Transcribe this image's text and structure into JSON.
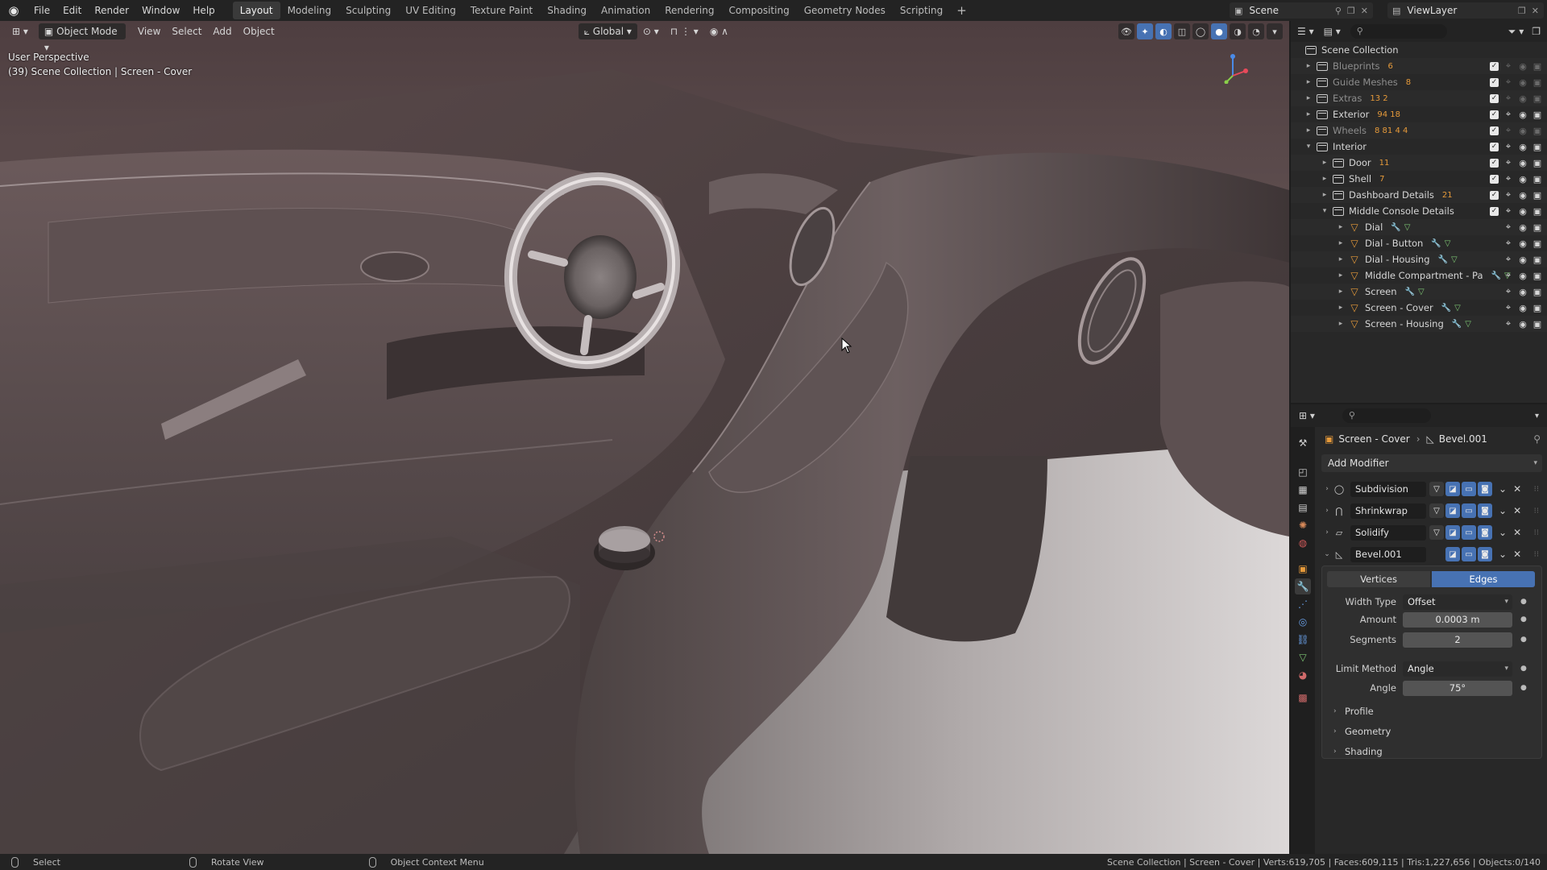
{
  "topbar": {
    "menus": [
      "File",
      "Edit",
      "Render",
      "Window",
      "Help"
    ],
    "workspaces": [
      "Layout",
      "Modeling",
      "Sculpting",
      "UV Editing",
      "Texture Paint",
      "Shading",
      "Animation",
      "Rendering",
      "Compositing",
      "Geometry Nodes",
      "Scripting"
    ],
    "active_workspace": "Layout",
    "add_workspace": "+",
    "scene": "Scene",
    "view_layer": "ViewLayer"
  },
  "viewport": {
    "mode": "Object Mode",
    "menus": [
      "View",
      "Select",
      "Add",
      "Object"
    ],
    "transform_orientation": "Global",
    "perspective": "User Perspective",
    "context": "(39) Scene Collection | Screen - Cover",
    "gizmo_axes": [
      "X",
      "Y",
      "Z"
    ]
  },
  "outliner": {
    "root": "Scene Collection",
    "rows": [
      {
        "name": "Blueprints",
        "badge": "6",
        "dim": true,
        "kind": "collection"
      },
      {
        "name": "Guide Meshes",
        "badge": "8",
        "dim": true,
        "kind": "collection"
      },
      {
        "name": "Extras",
        "badge": "13  2",
        "dim": true,
        "kind": "collection"
      },
      {
        "name": "Exterior",
        "badge": "94  18",
        "dim": false,
        "kind": "collection"
      },
      {
        "name": "Wheels",
        "badge": "8  81  4  4",
        "dim": true,
        "kind": "collection"
      },
      {
        "name": "Interior",
        "badge": "",
        "dim": false,
        "kind": "collection"
      },
      {
        "name": "Door",
        "badge": "11",
        "dim": false,
        "kind": "collection"
      },
      {
        "name": "Shell",
        "badge": "7",
        "dim": false,
        "kind": "collection"
      },
      {
        "name": "Dashboard Details",
        "badge": "21",
        "dim": false,
        "kind": "collection"
      },
      {
        "name": "Middle Console Details",
        "badge": "",
        "dim": false,
        "kind": "collection"
      },
      {
        "name": "Dial",
        "badge": "",
        "dim": false,
        "kind": "object"
      },
      {
        "name": "Dial - Button",
        "badge": "",
        "dim": false,
        "kind": "object"
      },
      {
        "name": "Dial - Housing",
        "badge": "",
        "dim": false,
        "kind": "object"
      },
      {
        "name": "Middle Compartment - Pa",
        "badge": "",
        "dim": false,
        "kind": "object"
      },
      {
        "name": "Screen",
        "badge": "",
        "dim": false,
        "kind": "object"
      },
      {
        "name": "Screen - Cover",
        "badge": "",
        "dim": false,
        "kind": "object"
      },
      {
        "name": "Screen - Housing",
        "badge": "",
        "dim": false,
        "kind": "object"
      }
    ]
  },
  "properties": {
    "object": "Screen - Cover",
    "modifier_path": "Bevel.001",
    "add_modifier": "Add Modifier",
    "modifiers": [
      "Subdivision",
      "Shrinkwrap",
      "Solidify",
      "Bevel.001"
    ],
    "bevel": {
      "affect_options": [
        "Vertices",
        "Edges"
      ],
      "affect_selected": "Edges",
      "width_type_label": "Width Type",
      "width_type": "Offset",
      "amount_label": "Amount",
      "amount": "0.0003 m",
      "segments_label": "Segments",
      "segments": "2",
      "limit_method_label": "Limit Method",
      "limit_method": "Angle",
      "angle_label": "Angle",
      "angle": "75°",
      "subpanels": [
        "Profile",
        "Geometry",
        "Shading"
      ]
    }
  },
  "statusbar": {
    "select": "Select",
    "rotate": "Rotate View",
    "context_menu": "Object Context Menu",
    "stats": "Scene Collection | Screen - Cover | Verts:619,705 | Faces:609,115 | Tris:1,227,656 | Objects:0/140"
  }
}
